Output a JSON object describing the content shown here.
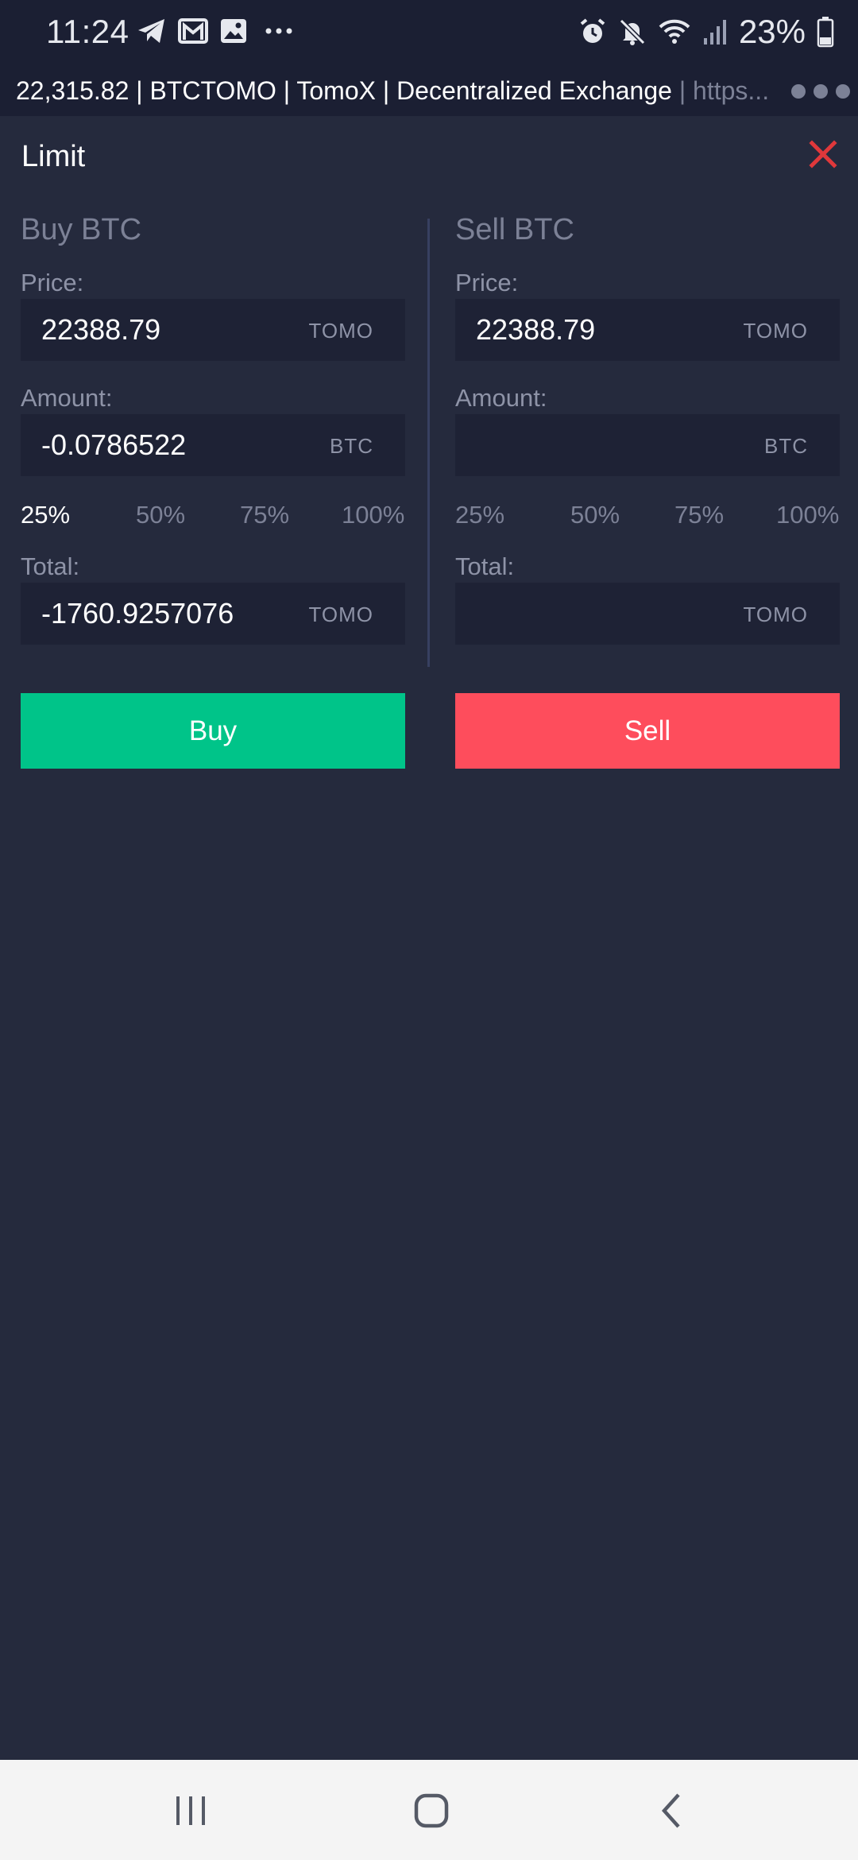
{
  "status_bar": {
    "time": "11:24",
    "battery": "23%",
    "icons_left": [
      "telegram-icon",
      "gmail-icon",
      "gallery-icon",
      "more-dots-icon"
    ],
    "icons_right": [
      "alarm-icon",
      "mute-icon",
      "wifi-icon",
      "signal-icon",
      "battery-icon"
    ]
  },
  "url_bar": {
    "title": "22,315.82 | BTCTOMO | TomoX | Decentralized Exchange ",
    "domain": "| https..."
  },
  "panel": {
    "title": "Limit"
  },
  "buy": {
    "heading": "Buy BTC",
    "price_label": "Price:",
    "price_value": "22388.79",
    "price_unit": "TOMO",
    "amount_label": "Amount:",
    "amount_value": "-0.0786522",
    "amount_unit": "BTC",
    "percents": [
      "25%",
      "50%",
      "75%",
      "100%"
    ],
    "active_percent": "25%",
    "total_label": "Total:",
    "total_value": "-1760.9257076",
    "total_unit": "TOMO",
    "button": "Buy"
  },
  "sell": {
    "heading": "Sell BTC",
    "price_label": "Price:",
    "price_value": "22388.79",
    "price_unit": "TOMO",
    "amount_label": "Amount:",
    "amount_value": "",
    "amount_unit": "BTC",
    "percents": [
      "25%",
      "50%",
      "75%",
      "100%"
    ],
    "total_label": "Total:",
    "total_value": "",
    "total_unit": "TOMO",
    "button": "Sell"
  },
  "colors": {
    "background": "#252a3d",
    "buy": "#00c489",
    "sell": "#fe4d5c",
    "close": "#e0383b"
  }
}
